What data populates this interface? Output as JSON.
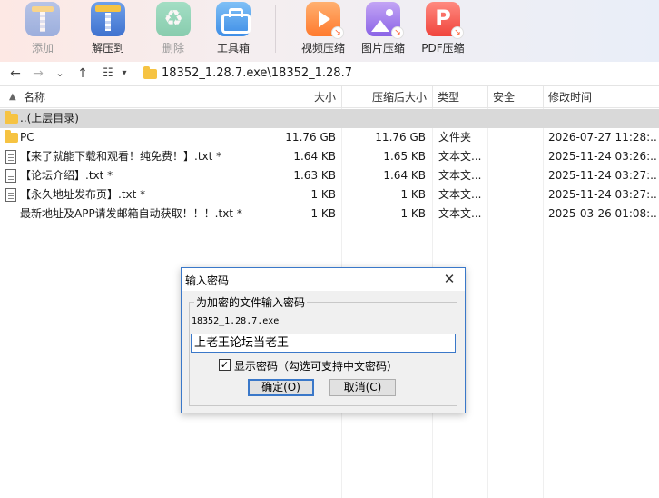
{
  "toolbar": {
    "add": "添加",
    "extract": "解压到",
    "delete": "删除",
    "tools": "工具箱",
    "video": "视频压缩",
    "image": "图片压缩",
    "pdf": "PDF压缩"
  },
  "address": {
    "path": "18352_1.28.7.exe\\18352_1.28.7"
  },
  "columns": {
    "name": "名称",
    "size": "大小",
    "packed": "压缩后大小",
    "type": "类型",
    "security": "安全",
    "modified": "修改时间"
  },
  "rows": [
    {
      "name": "..(上层目录)",
      "size": "",
      "packed": "",
      "type": "",
      "modified": "",
      "icon": "folder"
    },
    {
      "name": "PC",
      "size": "11.76 GB",
      "packed": "11.76 GB",
      "type": "文件夹",
      "modified": "2026-07-27 11:28:...",
      "icon": "folder"
    },
    {
      "name": "【来了就能下载和观看！纯免费！】.txt *",
      "size": "1.64 KB",
      "packed": "1.65 KB",
      "type": "文本文...",
      "modified": "2025-11-24 03:26:...",
      "icon": "file"
    },
    {
      "name": "【论坛介绍】.txt *",
      "size": "1.63 KB",
      "packed": "1.64 KB",
      "type": "文本文...",
      "modified": "2025-11-24 03:27:...",
      "icon": "file"
    },
    {
      "name": "【永久地址发布页】.txt *",
      "size": "1 KB",
      "packed": "1 KB",
      "type": "文本文...",
      "modified": "2025-11-24 03:27:...",
      "icon": "file"
    },
    {
      "name": "最新地址及APP请发邮箱自动获取！！！.txt *",
      "size": "1 KB",
      "packed": "1 KB",
      "type": "文本文...",
      "modified": "2025-03-26 01:08:...",
      "icon": "file"
    }
  ],
  "dialog": {
    "title": "输入密码",
    "close": "✕",
    "group_label": "为加密的文件输入密码",
    "filename": "18352_1.28.7.exe",
    "password": "上老王论坛当老王",
    "show_password_label": "显示密码（勾选可支持中文密码）",
    "show_password_checked": true,
    "ok": "确定(O)",
    "cancel": "取消(C)"
  },
  "colors": {
    "accent": "#3a78c9",
    "folder": "#f6c342",
    "selected_row": "#d9d9d9"
  }
}
